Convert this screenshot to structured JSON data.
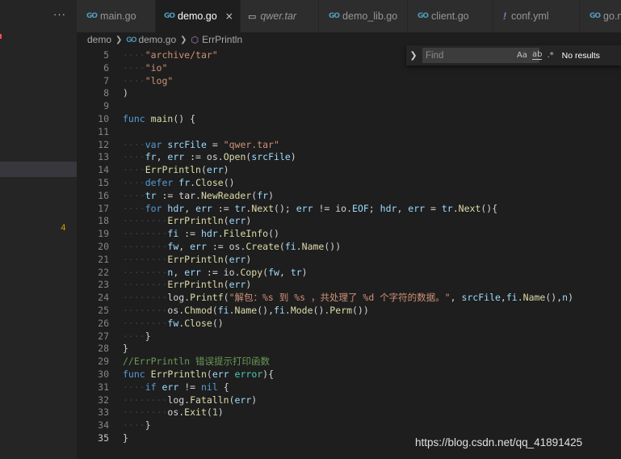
{
  "sidebar": {
    "ellipsis": "···",
    "problem_count": "4"
  },
  "tabs": [
    {
      "label": "main.go",
      "icon": "go-file-icon"
    },
    {
      "label": "demo.go",
      "icon": "go-file-icon",
      "active": true,
      "close": "×"
    },
    {
      "label": "qwer.tar",
      "icon": "archive-file-icon"
    },
    {
      "label": "demo_lib.go",
      "icon": "go-file-icon"
    },
    {
      "label": "client.go",
      "icon": "go-file-icon"
    },
    {
      "label": "conf.yml",
      "icon": "yaml-file-icon"
    },
    {
      "label": "go.mod",
      "icon": "go-file-icon"
    }
  ],
  "breadcrumb": {
    "folder": "demo",
    "file": "demo.go",
    "symbol": "ErrPrintln"
  },
  "find": {
    "placeholder": "Find",
    "match_case": "Aa",
    "whole_word": "ab",
    "regex": ".*",
    "result": "No results"
  },
  "editor": {
    "lines": [
      {
        "n": "5",
        "ws": "····",
        "parts": [
          [
            "str",
            "\"archive/tar\""
          ]
        ]
      },
      {
        "n": "6",
        "ws": "····",
        "parts": [
          [
            "str",
            "\"io\""
          ]
        ]
      },
      {
        "n": "7",
        "ws": "····",
        "parts": [
          [
            "str",
            "\"log\""
          ]
        ]
      },
      {
        "n": "8",
        "ws": "",
        "parts": [
          [
            "",
            ")"
          ]
        ]
      },
      {
        "n": "9",
        "ws": "",
        "parts": []
      },
      {
        "n": "10",
        "ws": "",
        "parts": [
          [
            "kw",
            "func"
          ],
          [
            "",
            " "
          ],
          [
            "fn",
            "main"
          ],
          [
            "",
            "() {"
          ]
        ]
      },
      {
        "n": "11",
        "ws": "",
        "parts": []
      },
      {
        "n": "12",
        "ws": "····",
        "parts": [
          [
            "kw",
            "var"
          ],
          [
            "",
            " "
          ],
          [
            "id",
            "srcFile"
          ],
          [
            "",
            " = "
          ],
          [
            "str",
            "\"qwer.tar\""
          ]
        ]
      },
      {
        "n": "13",
        "ws": "····",
        "parts": [
          [
            "id",
            "fr"
          ],
          [
            "",
            ", "
          ],
          [
            "id",
            "err"
          ],
          [
            "",
            " := "
          ],
          [
            "",
            "os."
          ],
          [
            "fn",
            "Open"
          ],
          [
            "",
            "("
          ],
          [
            "id",
            "srcFile"
          ],
          [
            "",
            ")"
          ]
        ]
      },
      {
        "n": "14",
        "ws": "····",
        "parts": [
          [
            "fn",
            "ErrPrintln"
          ],
          [
            "",
            "("
          ],
          [
            "id",
            "err"
          ],
          [
            "",
            ")"
          ]
        ]
      },
      {
        "n": "15",
        "ws": "····",
        "parts": [
          [
            "kw",
            "defer"
          ],
          [
            "",
            " "
          ],
          [
            "id",
            "fr"
          ],
          [
            "",
            "."
          ],
          [
            "fn",
            "Close"
          ],
          [
            "",
            "()"
          ]
        ]
      },
      {
        "n": "16",
        "ws": "····",
        "parts": [
          [
            "id",
            "tr"
          ],
          [
            "",
            " := "
          ],
          [
            "",
            "tar."
          ],
          [
            "fn",
            "NewReader"
          ],
          [
            "",
            "("
          ],
          [
            "id",
            "fr"
          ],
          [
            "",
            ")"
          ]
        ]
      },
      {
        "n": "17",
        "ws": "····",
        "parts": [
          [
            "kw",
            "for"
          ],
          [
            "",
            " "
          ],
          [
            "id",
            "hdr"
          ],
          [
            "",
            ", "
          ],
          [
            "id",
            "err"
          ],
          [
            "",
            " := "
          ],
          [
            "id",
            "tr"
          ],
          [
            "",
            "."
          ],
          [
            "fn",
            "Next"
          ],
          [
            "",
            "(); "
          ],
          [
            "id",
            "err"
          ],
          [
            "",
            " != "
          ],
          [
            "",
            "io."
          ],
          [
            "id",
            "EOF"
          ],
          [
            "",
            "; "
          ],
          [
            "id",
            "hdr"
          ],
          [
            "",
            ", "
          ],
          [
            "id",
            "err"
          ],
          [
            "",
            " = "
          ],
          [
            "id",
            "tr"
          ],
          [
            "",
            "."
          ],
          [
            "fn",
            "Next"
          ],
          [
            "",
            "(){"
          ]
        ]
      },
      {
        "n": "18",
        "ws": "········",
        "parts": [
          [
            "fn",
            "ErrPrintln"
          ],
          [
            "",
            "("
          ],
          [
            "id",
            "err"
          ],
          [
            "",
            ")"
          ]
        ]
      },
      {
        "n": "19",
        "ws": "········",
        "parts": [
          [
            "id",
            "fi"
          ],
          [
            "",
            " := "
          ],
          [
            "id",
            "hdr"
          ],
          [
            "",
            "."
          ],
          [
            "fn",
            "FileInfo"
          ],
          [
            "",
            "()"
          ]
        ]
      },
      {
        "n": "20",
        "ws": "········",
        "parts": [
          [
            "id",
            "fw"
          ],
          [
            "",
            ", "
          ],
          [
            "id",
            "err"
          ],
          [
            "",
            " := "
          ],
          [
            "",
            "os."
          ],
          [
            "fn",
            "Create"
          ],
          [
            "",
            "("
          ],
          [
            "id",
            "fi"
          ],
          [
            "",
            "."
          ],
          [
            "fn",
            "Name"
          ],
          [
            "",
            "())"
          ]
        ]
      },
      {
        "n": "21",
        "ws": "········",
        "parts": [
          [
            "fn",
            "ErrPrintln"
          ],
          [
            "",
            "("
          ],
          [
            "id",
            "err"
          ],
          [
            "",
            ")"
          ]
        ]
      },
      {
        "n": "22",
        "ws": "········",
        "parts": [
          [
            "id",
            "n"
          ],
          [
            "",
            ", "
          ],
          [
            "id",
            "err"
          ],
          [
            "",
            " := "
          ],
          [
            "",
            "io."
          ],
          [
            "fn",
            "Copy"
          ],
          [
            "",
            "("
          ],
          [
            "id",
            "fw"
          ],
          [
            "",
            ", "
          ],
          [
            "id",
            "tr"
          ],
          [
            "",
            ")"
          ]
        ]
      },
      {
        "n": "23",
        "ws": "········",
        "parts": [
          [
            "fn",
            "ErrPrintln"
          ],
          [
            "",
            "("
          ],
          [
            "id",
            "err"
          ],
          [
            "",
            ")"
          ]
        ]
      },
      {
        "n": "24",
        "ws": "········",
        "parts": [
          [
            "",
            "log."
          ],
          [
            "fn",
            "Printf"
          ],
          [
            "",
            "("
          ],
          [
            "str",
            "\"解包：%s 到 %s ，共处理了 %d 个字符的数据。\""
          ],
          [
            "",
            ", "
          ],
          [
            "id",
            "srcFile"
          ],
          [
            "",
            ","
          ],
          [
            "id",
            "fi"
          ],
          [
            "",
            "."
          ],
          [
            "fn",
            "Name"
          ],
          [
            "",
            "(),"
          ],
          [
            "id",
            "n"
          ],
          [
            "",
            ")"
          ]
        ]
      },
      {
        "n": "25",
        "ws": "········",
        "parts": [
          [
            "",
            "os."
          ],
          [
            "fn",
            "Chmod"
          ],
          [
            "",
            "("
          ],
          [
            "id",
            "fi"
          ],
          [
            "",
            "."
          ],
          [
            "fn",
            "Name"
          ],
          [
            "",
            "(),"
          ],
          [
            "id",
            "fi"
          ],
          [
            "",
            "."
          ],
          [
            "fn",
            "Mode"
          ],
          [
            "",
            "()."
          ],
          [
            "fn",
            "Perm"
          ],
          [
            "",
            "())"
          ]
        ]
      },
      {
        "n": "26",
        "ws": "········",
        "parts": [
          [
            "id",
            "fw"
          ],
          [
            "",
            "."
          ],
          [
            "fn",
            "Close"
          ],
          [
            "",
            "()"
          ]
        ]
      },
      {
        "n": "27",
        "ws": "····",
        "parts": [
          [
            "",
            "}"
          ]
        ]
      },
      {
        "n": "28",
        "ws": "",
        "parts": [
          [
            "",
            "}"
          ]
        ]
      },
      {
        "n": "29",
        "ws": "",
        "parts": [
          [
            "cm",
            "//ErrPrintln 错误提示打印函数"
          ]
        ]
      },
      {
        "n": "30",
        "ws": "",
        "parts": [
          [
            "kw",
            "func"
          ],
          [
            "",
            " "
          ],
          [
            "fn",
            "ErrPrintln"
          ],
          [
            "",
            "("
          ],
          [
            "id",
            "err"
          ],
          [
            "",
            " "
          ],
          [
            "ty",
            "error"
          ],
          [
            "",
            "){"
          ]
        ]
      },
      {
        "n": "31",
        "ws": "····",
        "parts": [
          [
            "kw",
            "if"
          ],
          [
            "",
            " "
          ],
          [
            "id",
            "err"
          ],
          [
            "",
            " != "
          ],
          [
            "kw",
            "nil"
          ],
          [
            "",
            " {"
          ]
        ]
      },
      {
        "n": "32",
        "ws": "········",
        "parts": [
          [
            "",
            "log."
          ],
          [
            "fn",
            "Fatalln"
          ],
          [
            "",
            "("
          ],
          [
            "id",
            "err"
          ],
          [
            "",
            ")"
          ]
        ]
      },
      {
        "n": "33",
        "ws": "········",
        "parts": [
          [
            "",
            "os."
          ],
          [
            "fn",
            "Exit"
          ],
          [
            "",
            "("
          ],
          [
            "num",
            "1"
          ],
          [
            "",
            ")"
          ]
        ]
      },
      {
        "n": "34",
        "ws": "····",
        "parts": [
          [
            "",
            "}"
          ]
        ]
      },
      {
        "n": "35",
        "ws": "",
        "parts": [
          [
            "",
            "}"
          ]
        ],
        "current": true
      }
    ]
  },
  "watermark": "https://blog.csdn.net/qq_41891425"
}
